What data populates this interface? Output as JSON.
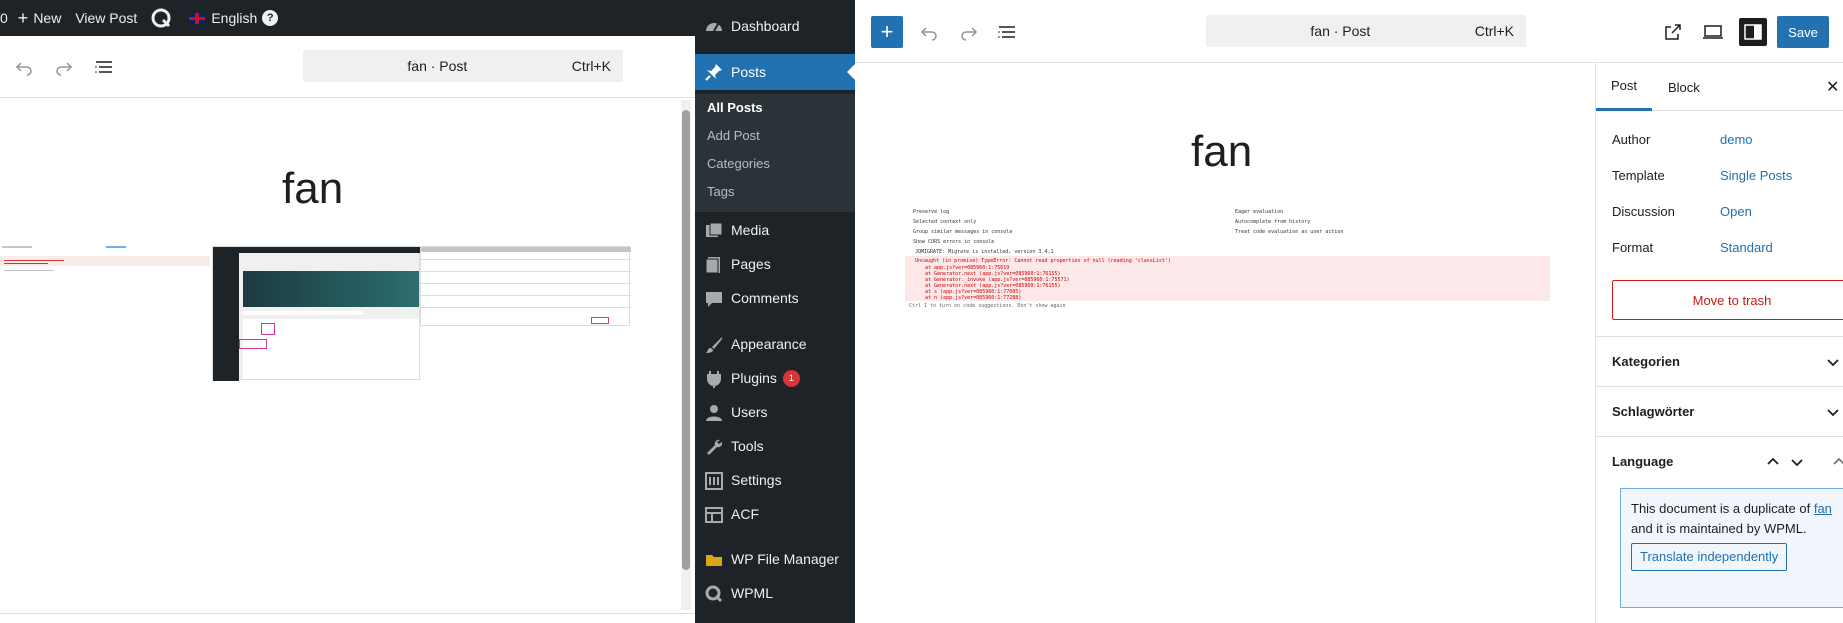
{
  "admin_bar": {
    "counter": "0",
    "new_label": "New",
    "view_post_label": "View Post",
    "language_label": "English",
    "help_label": "?"
  },
  "left_editor": {
    "command_title": "fan · Post",
    "command_shortcut": "Ctrl+K",
    "post_title": "fan"
  },
  "admin_menu": {
    "dashboard": "Dashboard",
    "posts": "Posts",
    "submenu": {
      "all_posts": "All Posts",
      "add_post": "Add Post",
      "categories": "Categories",
      "tags": "Tags"
    },
    "media": "Media",
    "pages": "Pages",
    "comments": "Comments",
    "appearance": "Appearance",
    "plugins": "Plugins",
    "plugins_badge": "1",
    "users": "Users",
    "tools": "Tools",
    "settings": "Settings",
    "acf": "ACF",
    "wp_file_manager": "WP File Manager",
    "wpml": "WPML"
  },
  "right_editor": {
    "command_title": "fan · Post",
    "command_shortcut": "Ctrl+K",
    "save_label": "Save",
    "post_title": "fan",
    "console_lines": {
      "log_opt1": "Preserve log",
      "log_opt2": "Selected context only",
      "log_opt3": "Group similar messages in console",
      "log_opt4": "Show CORS errors in console",
      "log_opt5": "Eager evaluation",
      "log_opt6": "Autocomplete from history",
      "log_opt7": "Treat code evaluation as user action",
      "line1": "JQMIGRATE: Migrate is installed, version 3.4.1",
      "line2": "Uncaught (in promise) TypeError: Cannot read properties of null (reading 'classList')",
      "line3": "at app.js?ver=085960:1:75619",
      "line4": "at Generator.next (app.js?ver=085960:1:76155)",
      "line5": "at Generator._invoke (app.js?ver=085960:1:75571)",
      "line6": "at Generator.next (app.js?ver=085960:1:76155)",
      "line7": "at s (app.js?ver=085960:1:77085)",
      "line8": "at n (app.js?ver=085960:1:77288)",
      "line9": "Ctrl I to turn on code suggestions. Don't show again"
    }
  },
  "sidebar": {
    "tab_post": "Post",
    "tab_block": "Block",
    "author_label": "Author",
    "author_value": "demo",
    "template_label": "Template",
    "template_value": "Single Posts",
    "discussion_label": "Discussion",
    "discussion_value": "Open",
    "format_label": "Format",
    "format_value": "Standard",
    "trash_label": "Move to trash",
    "kategorien": "Kategorien",
    "schlagwoerter": "Schlagwörter",
    "language": "Language",
    "notice_pre": "This document is a duplicate of",
    "notice_link": "fan",
    "notice_post": "and it is maintained by WPML.",
    "translate_button": "Translate independently"
  },
  "colors": {
    "accent": "#2271b1",
    "admin_bg": "#1d2327",
    "danger": "#cc1818"
  }
}
